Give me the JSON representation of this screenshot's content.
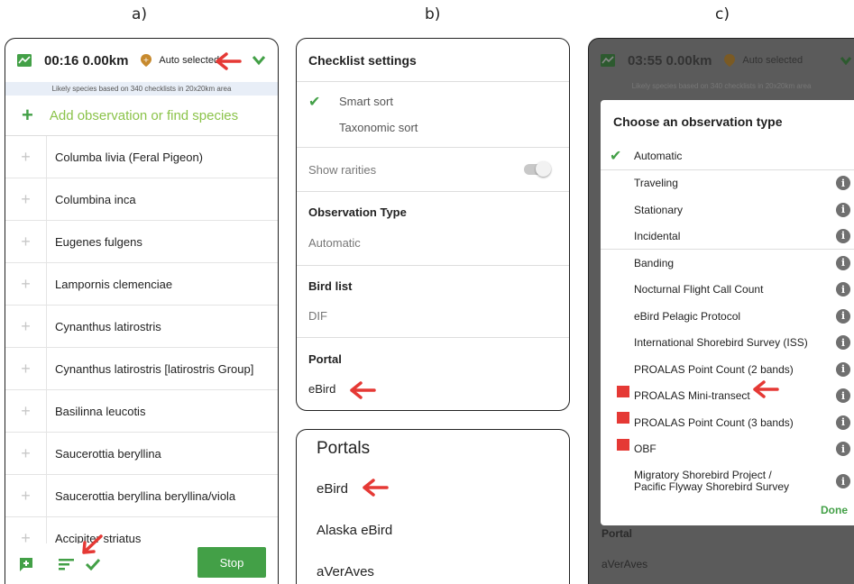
{
  "labels": {
    "a": "a)",
    "b": "b)",
    "c": "c)"
  },
  "panel_a": {
    "time_distance": "00:16 0.00km",
    "auto_selected": "Auto selected",
    "subtitle": "Likely species based on 340 checklists in 20x20km area",
    "add_placeholder": "Add observation or find species",
    "species": [
      "Columba livia (Feral Pigeon)",
      "Columbina inca",
      "Eugenes fulgens",
      "Lampornis clemenciae",
      "Cynanthus latirostris",
      "Cynanthus latirostris [latirostris Group]",
      "Basilinna leucotis",
      "Saucerottia beryllina",
      "Saucerottia beryllina beryllina/viola",
      "Accipiter striatus"
    ],
    "stop_label": "Stop"
  },
  "panel_b": {
    "header": "Checklist settings",
    "smart_sort": "Smart sort",
    "taxonomic_sort": "Taxonomic sort",
    "show_rarities": "Show rarities",
    "observation_type_title": "Observation Type",
    "observation_type_value": "Automatic",
    "bird_list_title": "Bird list",
    "bird_list_value": "DIF",
    "portal_title": "Portal",
    "portal_value": "eBird"
  },
  "panel_b2": {
    "title": "Portals",
    "items": [
      "eBird",
      "Alaska eBird",
      "aVerAves"
    ]
  },
  "panel_c": {
    "time_distance": "03:55 0.00km",
    "auto_selected": "Auto selected",
    "subtitle": "Likely species based on 340 checklists in 20x20km area",
    "dialog_title": "Choose an observation type",
    "options": [
      {
        "label": "Automatic",
        "checked": true,
        "info": false,
        "marked": false
      },
      {
        "label": "Traveling",
        "checked": false,
        "info": true,
        "marked": false
      },
      {
        "label": "Stationary",
        "checked": false,
        "info": true,
        "marked": false
      },
      {
        "label": "Incidental",
        "checked": false,
        "info": true,
        "marked": false
      },
      {
        "label": "Banding",
        "checked": false,
        "info": true,
        "marked": false
      },
      {
        "label": "Nocturnal Flight Call Count",
        "checked": false,
        "info": true,
        "marked": false
      },
      {
        "label": "eBird Pelagic Protocol",
        "checked": false,
        "info": true,
        "marked": false
      },
      {
        "label": "International Shorebird Survey (ISS)",
        "checked": false,
        "info": true,
        "marked": false
      },
      {
        "label": "PROALAS Point Count (2 bands)",
        "checked": false,
        "info": true,
        "marked": false
      },
      {
        "label": "PROALAS Mini-transect",
        "checked": false,
        "info": true,
        "marked": true
      },
      {
        "label": "PROALAS Point Count (3 bands)",
        "checked": false,
        "info": true,
        "marked": true
      },
      {
        "label": "OBF",
        "checked": false,
        "info": true,
        "marked": true
      }
    ],
    "last_option": [
      "Migratory Shorebird Project /",
      "Pacific Flyway Shorebird Survey"
    ],
    "done_label": "Done",
    "bg_portal": "Portal",
    "bg_portal_value": "aVerAves"
  },
  "colors": {
    "green": "#43a047",
    "light_green": "#8bc34a",
    "red_arrow": "#e53935",
    "overlay": "#5b5b5b"
  },
  "icons": [
    "map-icon",
    "location-pin-icon",
    "checkmark-icon",
    "plus-icon",
    "add-note-icon",
    "sort-icon",
    "info-icon",
    "arrow-icon"
  ]
}
